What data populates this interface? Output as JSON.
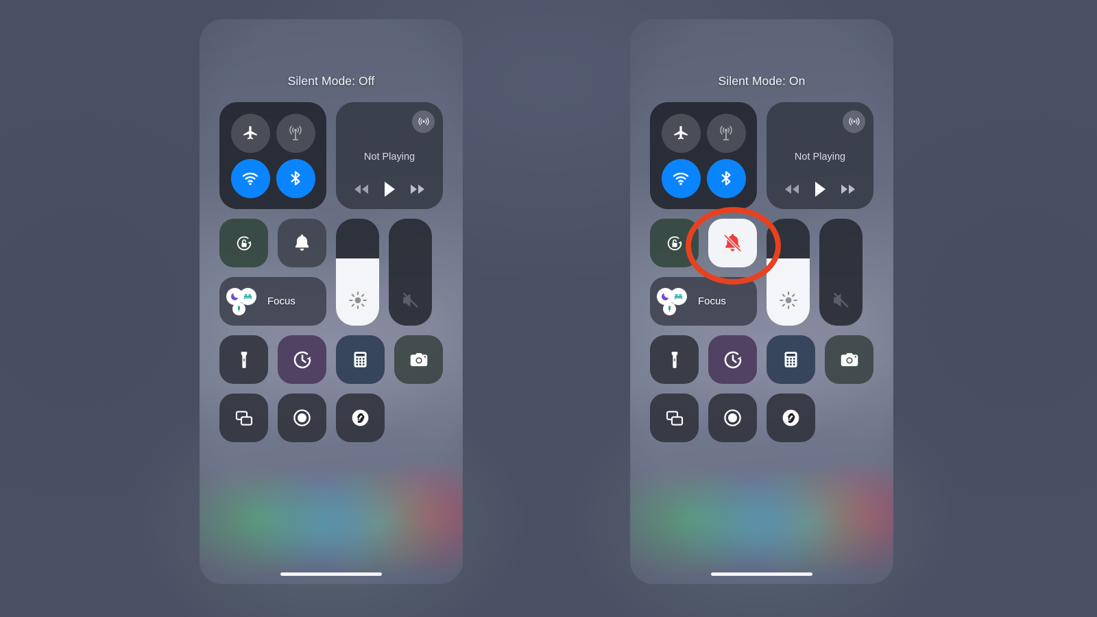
{
  "background_color": "#4a5064",
  "accent_color": "#0a84ff",
  "highlight_ring_color": "#e8411f",
  "active_tile_color": "#f3f4f7",
  "silent_icon_color": "#e8413e",
  "phones": [
    {
      "id": "left",
      "banner": "Silent Mode: Off",
      "connectivity": {
        "airplane": {
          "label": "Airplane Mode",
          "state": "off"
        },
        "cellular": {
          "label": "Cellular Data",
          "state": "off"
        },
        "wifi": {
          "label": "Wi-Fi",
          "state": "on"
        },
        "bluetooth": {
          "label": "Bluetooth",
          "state": "on"
        }
      },
      "media": {
        "title": "Not Playing",
        "airplay_label": "AirPlay",
        "rewind_label": "Rewind",
        "play_label": "Play",
        "forward_label": "Fast Forward"
      },
      "rotation_lock": {
        "label": "Rotation Lock",
        "state": "unlocked"
      },
      "ringer": {
        "label": "Silent Mode",
        "state": "off",
        "icon": "bell-icon"
      },
      "focus": {
        "label": "Focus",
        "modes": [
          "Do Not Disturb",
          "Sleep",
          "Personal"
        ]
      },
      "brightness": {
        "label": "Brightness",
        "value": 63
      },
      "volume": {
        "label": "Volume",
        "value": 0,
        "muted": true
      },
      "apps_row_1": [
        {
          "label": "Flashlight",
          "icon": "flashlight-icon",
          "tint": "dark"
        },
        {
          "label": "Timer",
          "icon": "timer-icon",
          "tint": "purple"
        },
        {
          "label": "Calculator",
          "icon": "calculator-icon",
          "tint": "navy"
        },
        {
          "label": "Camera",
          "icon": "camera-icon",
          "tint": "olive"
        }
      ],
      "apps_row_2": [
        {
          "label": "Screen Mirroring",
          "icon": "screen-mirroring-icon",
          "tint": "dark"
        },
        {
          "label": "Screen Recording",
          "icon": "screen-record-icon",
          "tint": "dark"
        },
        {
          "label": "Shazam",
          "icon": "shazam-icon",
          "tint": "dark"
        }
      ],
      "highlighted": false
    },
    {
      "id": "right",
      "banner": "Silent Mode: On",
      "connectivity": {
        "airplane": {
          "label": "Airplane Mode",
          "state": "off"
        },
        "cellular": {
          "label": "Cellular Data",
          "state": "off"
        },
        "wifi": {
          "label": "Wi-Fi",
          "state": "on"
        },
        "bluetooth": {
          "label": "Bluetooth",
          "state": "on"
        }
      },
      "media": {
        "title": "Not Playing",
        "airplay_label": "AirPlay",
        "rewind_label": "Rewind",
        "play_label": "Play",
        "forward_label": "Fast Forward"
      },
      "rotation_lock": {
        "label": "Rotation Lock",
        "state": "unlocked"
      },
      "ringer": {
        "label": "Silent Mode",
        "state": "on",
        "icon": "bell-slash-icon"
      },
      "focus": {
        "label": "Focus",
        "modes": [
          "Do Not Disturb",
          "Sleep",
          "Personal"
        ]
      },
      "brightness": {
        "label": "Brightness",
        "value": 63
      },
      "volume": {
        "label": "Volume",
        "value": 0,
        "muted": true
      },
      "apps_row_1": [
        {
          "label": "Flashlight",
          "icon": "flashlight-icon",
          "tint": "dark"
        },
        {
          "label": "Timer",
          "icon": "timer-icon",
          "tint": "purple"
        },
        {
          "label": "Calculator",
          "icon": "calculator-icon",
          "tint": "navy"
        },
        {
          "label": "Camera",
          "icon": "camera-icon",
          "tint": "olive"
        }
      ],
      "apps_row_2": [
        {
          "label": "Screen Mirroring",
          "icon": "screen-mirroring-icon",
          "tint": "dark"
        },
        {
          "label": "Screen Recording",
          "icon": "screen-record-icon",
          "tint": "dark"
        },
        {
          "label": "Shazam",
          "icon": "shazam-icon",
          "tint": "dark"
        }
      ],
      "highlighted": true
    }
  ]
}
